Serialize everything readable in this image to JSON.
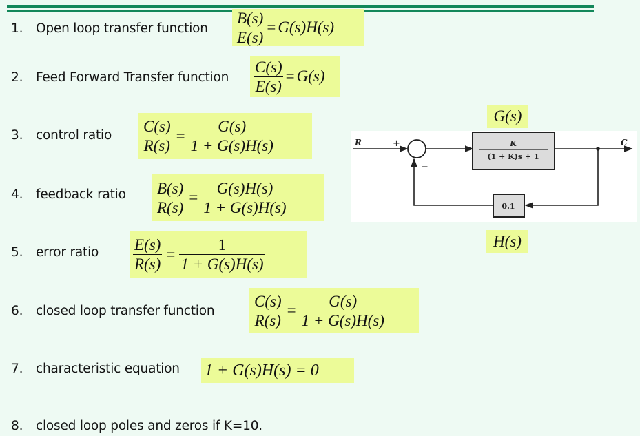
{
  "header_rule_color": "#13875a",
  "highlight_color": "#ecfb98",
  "items": [
    {
      "num": "1.",
      "label": "Open loop transfer function",
      "eq": {
        "lhs_num": "B(s)",
        "lhs_den": "E(s)",
        "eq_sign": "=",
        "rhs": "G(s)H(s)"
      }
    },
    {
      "num": "2.",
      "label": "Feed Forward Transfer function",
      "eq": {
        "lhs_num": "C(s)",
        "lhs_den": "E(s)",
        "eq_sign": "=",
        "rhs": "G(s)"
      }
    },
    {
      "num": "3.",
      "label": "control ratio",
      "eq": {
        "lhs_num": "C(s)",
        "lhs_den": "R(s)",
        "eq_sign": "=",
        "rhs_num": "G(s)",
        "rhs_den": "1 + G(s)H(s)"
      }
    },
    {
      "num": "4.",
      "label": "feedback ratio",
      "eq": {
        "lhs_num": "B(s)",
        "lhs_den": "R(s)",
        "eq_sign": "=",
        "rhs_num": "G(s)H(s)",
        "rhs_den": "1 + G(s)H(s)"
      }
    },
    {
      "num": "5.",
      "label": "error ratio",
      "eq": {
        "lhs_num": "E(s)",
        "lhs_den": "R(s)",
        "eq_sign": "=",
        "rhs_num": "1",
        "rhs_den": "1 + G(s)H(s)"
      }
    },
    {
      "num": "6.",
      "label": "closed loop transfer function",
      "eq": {
        "lhs_num": "C(s)",
        "lhs_den": "R(s)",
        "eq_sign": "=",
        "rhs_num": "G(s)",
        "rhs_den": "1 + G(s)H(s)"
      }
    },
    {
      "num": "7.",
      "label": "characteristic equation",
      "eq": {
        "text": "1 + G(s)H(s) = 0"
      }
    },
    {
      "num": "8.",
      "label": "closed loop poles and zeros if K=10."
    }
  ],
  "diagram": {
    "g_label": "G(s)",
    "h_label": "H(s)",
    "input": "R",
    "output": "C",
    "plus_sign": "+",
    "minus_sign": "−",
    "forward_block_num": "K",
    "forward_block_den": "(1 + K)s + 1",
    "feedback_block": "0.1"
  }
}
